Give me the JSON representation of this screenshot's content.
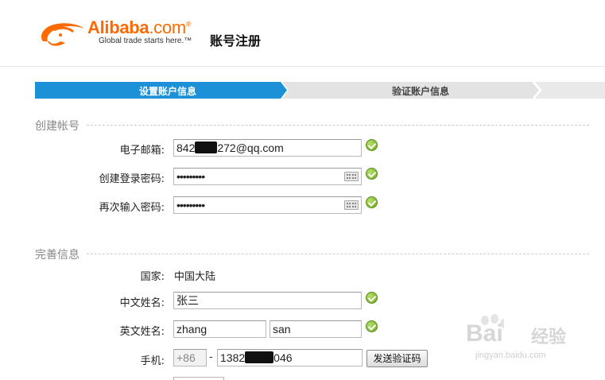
{
  "header": {
    "logo_word": "Alibaba",
    "logo_dotcom": ".com",
    "logo_registered": "®",
    "slogan": "Global trade starts here.™",
    "page_title": "账号注册"
  },
  "steps": [
    {
      "label": "设置账户信息",
      "active": true
    },
    {
      "label": "验证账户信息",
      "active": false
    }
  ],
  "account_section": {
    "title": "创建帐号",
    "email": {
      "label": "电子邮箱:",
      "value_prefix": "842",
      "value_suffix": "272@qq.com"
    },
    "password": {
      "label": "创建登录密码:",
      "value": "•••••••••"
    },
    "confirm_password": {
      "label": "再次输入密码:",
      "value": "•••••••••"
    }
  },
  "info_section": {
    "title": "完善信息",
    "country": {
      "label": "国家:",
      "value": "中国大陆"
    },
    "chinese_name": {
      "label": "中文姓名:",
      "value": "张三"
    },
    "english_name": {
      "label": "英文姓名:",
      "first": "zhang",
      "last": "san"
    },
    "mobile": {
      "label": "手机:",
      "country_code": "+86",
      "separator": "-",
      "number_prefix": "1382",
      "number_suffix": "046",
      "send_code_label": "发送验证码"
    }
  },
  "icons": {
    "valid": "check-circle-icon",
    "keyboard": "keyboard-icon"
  },
  "watermark": {
    "brand": "Bai",
    "brand_cn": "经验",
    "url": "jingyan.baidu.com"
  },
  "colors": {
    "brand_orange": "#ff6a00",
    "step_active": "#1d91d8",
    "step_inactive": "#e3e3e3",
    "valid_green": "#6aa51d"
  }
}
